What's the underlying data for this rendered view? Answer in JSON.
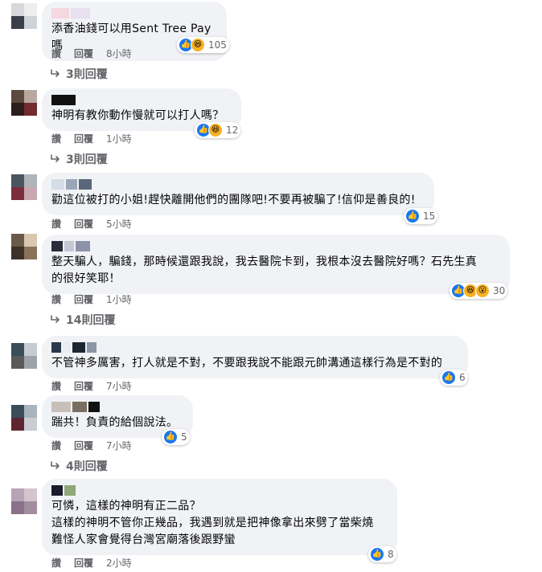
{
  "ui": {
    "reply_label": "回覆",
    "like_label": "讚"
  },
  "comments": [
    {
      "text": "添香油錢可以用Sent Tree Pay嗎",
      "time": "8小時",
      "reaction_count": "105",
      "reaction_types": [
        "like-icon",
        "haha-icon"
      ],
      "replies_label": "3則回覆"
    },
    {
      "text": "神明有教你動作慢就可以打人嗎？",
      "time": "1小時",
      "reaction_count": "12",
      "reaction_types": [
        "like-icon",
        "haha-icon"
      ],
      "replies_label": "3則回覆"
    },
    {
      "text": "勸這位被打的小姐!趕快離開他們的團隊吧!不要再被騙了!信仰是善良的!",
      "time": "5小時",
      "reaction_count": "15",
      "reaction_types": [
        "like-icon"
      ],
      "replies_label": ""
    },
    {
      "text": "整天騙人，騙錢，那時候還跟我說，我去醫院卡到，我根本沒去醫院好嗎？石先生真\n的很好笑耶！",
      "time": "1小時",
      "reaction_count": "30",
      "reaction_types": [
        "like-icon",
        "haha-icon",
        "wow-icon"
      ],
      "replies_label": "14則回覆"
    },
    {
      "text": "不管神多厲害，打人就是不對，不要跟我說不能跟元帥溝通這樣行為是不對的",
      "time": "7小時",
      "reaction_count": "6",
      "reaction_types": [
        "like-icon"
      ],
      "replies_label": ""
    },
    {
      "text": "踹共！負責的給個說法。",
      "time": "7小時",
      "reaction_count": "5",
      "reaction_types": [
        "like-icon"
      ],
      "replies_label": "4則回覆"
    },
    {
      "text": "可憐，這樣的神明有正二品？\n這樣的神明不管你正幾品，我遇到就是把神像拿出來劈了當柴燒\n難怪人家會覺得台灣宮廟落後跟野蠻",
      "time": "2小時",
      "reaction_count": "8",
      "reaction_types": [
        "like-icon"
      ],
      "replies_label": ""
    }
  ],
  "colors": {
    "bubble": "#f0f2f5",
    "secondary_text": "#65676b",
    "like_blue": "#1877f2",
    "haha_yellow": "#f7b125"
  }
}
